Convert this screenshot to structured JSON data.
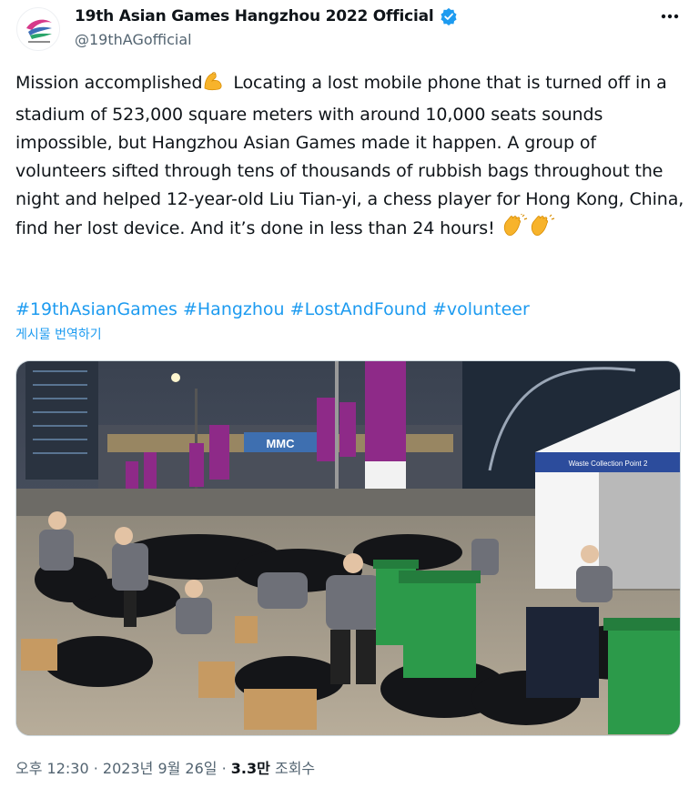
{
  "account": {
    "display_name": "19th Asian Games Hangzhou 2022 Official",
    "handle": "@19thAGofficial"
  },
  "tweet": {
    "text_part1": "Mission accomplished",
    "text_part2": " Locating a lost mobile phone that is turned off in a stadium of 523,000 square meters with around 10,000 seats sounds impossible, but Hangzhou Asian Games made it happen. A group of volunteers sifted through tens of thousands of rubbish bags throughout the night and helped 12-year-old Liu Tian-yi, a chess player for Hong Kong, China, find her lost device. And it’s done in less than 24 hours! ",
    "hashtags": [
      "#19thAsianGames",
      "#Hangzhou",
      "#LostAndFound",
      "#volunteer"
    ],
    "translate_label": "게시물 번역하기"
  },
  "media": {
    "sign_text": "MMC",
    "tent_text": "Waste Collection Point 2"
  },
  "meta": {
    "time": "오후 12:30",
    "date": "2023년 9월 26일",
    "views_count": "3.3만",
    "views_label": "조회수",
    "separator": "·"
  },
  "icons": {
    "verified": "verified-badge-icon",
    "more": "more-options-icon",
    "flex": "flexed-biceps-emoji",
    "clap": "clapping-hands-emoji"
  },
  "colors": {
    "link": "#1d9bf0",
    "secondary_text": "#536471",
    "banner_purple": "#8e2a88",
    "bin_green": "#2c9a4a"
  }
}
